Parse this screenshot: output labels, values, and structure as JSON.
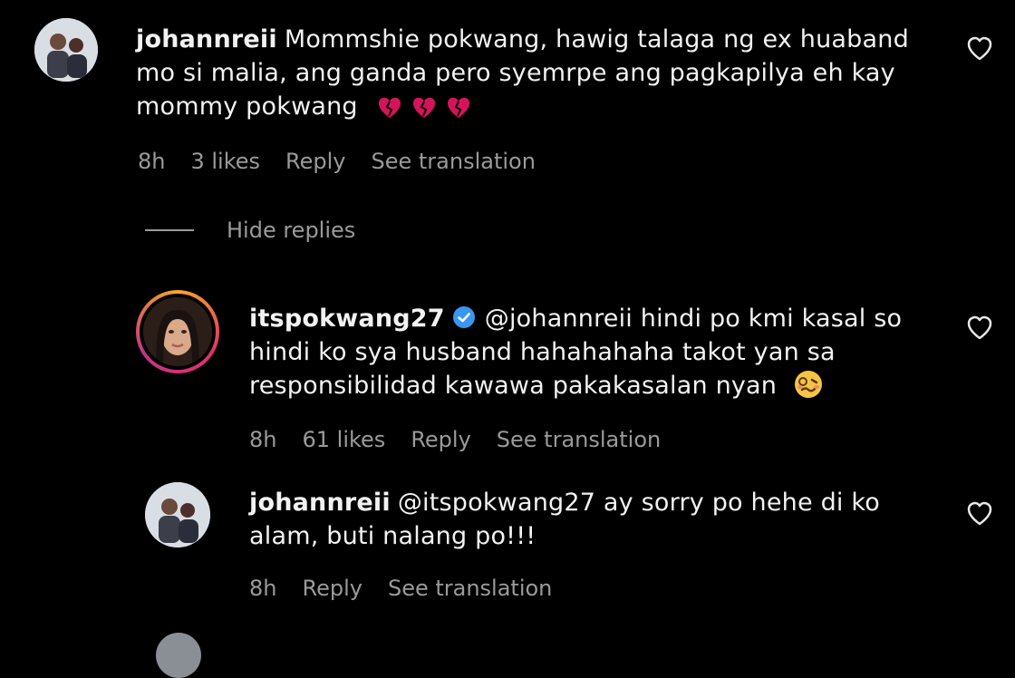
{
  "comments": [
    {
      "username": "johannreii",
      "text": "Mommshie pokwang, hawig talaga ng ex huaband mo si malia, ang ganda pero syemrpe ang pagkapilya eh kay mommy pokwang",
      "emoji": "broken-heart ×3",
      "time": "8h",
      "likes": "3 likes",
      "reply": "Reply",
      "translate": "See translation"
    },
    {
      "username": "itspokwang27",
      "verified": true,
      "mention": "@johannreii",
      "text": "hindi po kmi kasal so hindi ko sya husband hahahahaha takot yan sa responsibilidad kawawa pakakasalan nyan",
      "emoji": "woozy-face",
      "time": "8h",
      "likes": "61 likes",
      "reply": "Reply",
      "translate": "See translation"
    },
    {
      "username": "johannreii",
      "mention": "@itspokwang27",
      "text": "ay sorry po hehe di ko alam, buti nalang po!!!",
      "time": "8h",
      "reply": "Reply",
      "translate": "See translation"
    }
  ],
  "hide_replies": "Hide replies",
  "colors": {
    "background": "#000000",
    "text": "#f2f2f2",
    "muted": "#9a9a9a",
    "verified": "#3897f0",
    "broken_heart": "#d4145a"
  }
}
